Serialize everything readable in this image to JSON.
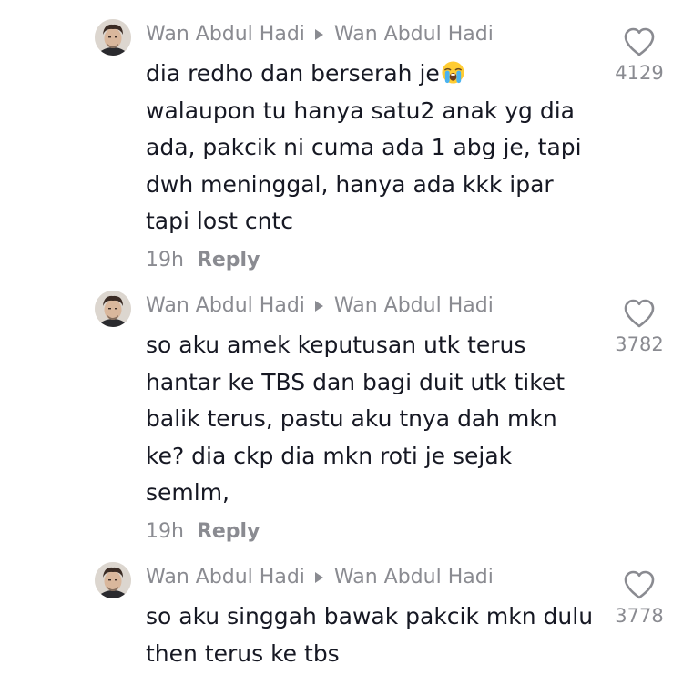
{
  "comments": [
    {
      "author": "Wan Abdul Hadi",
      "reply_to": "Wan Abdul Hadi",
      "text": "dia redho dan berserah je",
      "text_emoji": "loudly-crying-face-emoji",
      "text_rest": "walaupon tu hanya satu2 anak yg dia ada, pakcik ni cuma ada 1 abg je, tapi dwh meninggal, hanya ada kkk ipar tapi lost cntc",
      "time": "19h",
      "reply_label": "Reply",
      "likes": "4129"
    },
    {
      "author": "Wan Abdul Hadi",
      "reply_to": "Wan Abdul Hadi",
      "text": "so aku amek keputusan utk terus hantar ke TBS dan bagi duit utk tiket balik terus, pastu aku tnya dah mkn ke? dia ckp dia mkn roti je sejak semlm,",
      "time": "19h",
      "reply_label": "Reply",
      "likes": "3782"
    },
    {
      "author": "Wan Abdul Hadi",
      "reply_to": "Wan Abdul Hadi",
      "text": "so aku singgah bawak pakcik mkn dulu then terus ke tbs",
      "likes": "3778"
    }
  ],
  "colors": {
    "text": "#161823",
    "secondary": "#8a8b91",
    "background": "#ffffff"
  }
}
